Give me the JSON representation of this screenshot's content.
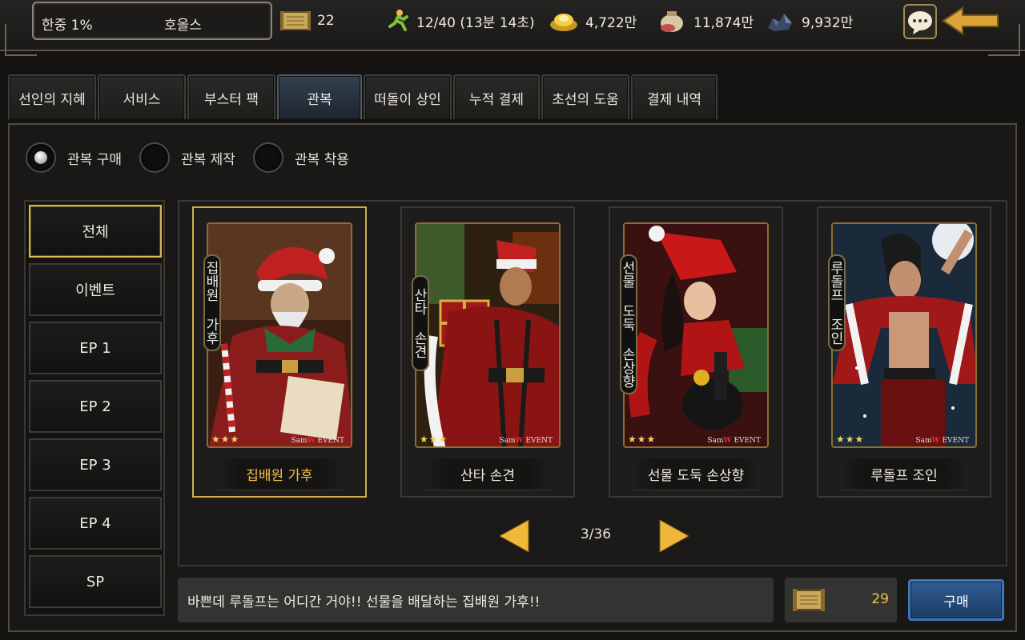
{
  "topbar": {
    "rank": "한중 1%",
    "player_name": "호올스",
    "scroll_count": "22",
    "stamina": "12/40 (13분 14초)",
    "gold": "4,722만",
    "food": "11,874만",
    "ore": "9,932만"
  },
  "tabs": [
    {
      "label": "선인의 지혜"
    },
    {
      "label": "서비스"
    },
    {
      "label": "부스터 팩"
    },
    {
      "label": "관복",
      "active": true
    },
    {
      "label": "떠돌이 상인"
    },
    {
      "label": "누적 결제"
    },
    {
      "label": "초선의 도움"
    },
    {
      "label": "결제 내역"
    }
  ],
  "modes": [
    {
      "label": "관복 구매",
      "selected": true
    },
    {
      "label": "관복 제작",
      "selected": false
    },
    {
      "label": "관복 착용",
      "selected": false
    }
  ],
  "categories": [
    {
      "label": "전체",
      "active": true
    },
    {
      "label": "이벤트"
    },
    {
      "label": "EP 1"
    },
    {
      "label": "EP 2"
    },
    {
      "label": "EP 3"
    },
    {
      "label": "EP 4"
    },
    {
      "label": "SP"
    }
  ],
  "cards": [
    {
      "title": "집배원 가후",
      "vertical_name": "집배원 가후",
      "stars": "★★★",
      "tag_pre": "Sam",
      "tag_mid": "W",
      "tag_post": "EVENT",
      "selected": true
    },
    {
      "title": "산타 손견",
      "vertical_name": "산타 손견",
      "stars": "★★★",
      "tag_pre": "Sam",
      "tag_mid": "W",
      "tag_post": "EVENT"
    },
    {
      "title": "선물 도둑 손상향",
      "vertical_name": "선물 도둑 손상향",
      "stars": "★★★",
      "tag_pre": "Sam",
      "tag_mid": "W",
      "tag_post": "EVENT"
    },
    {
      "title": "루돌프 조인",
      "vertical_name": "루돌프 조인",
      "stars": "★★★",
      "tag_pre": "Sam",
      "tag_mid": "W",
      "tag_post": "EVENT"
    }
  ],
  "pager": {
    "text": "3/36"
  },
  "description": "바쁜데 루돌프는 어디간 거야!! 선물을 배달하는 집배원 가후!!",
  "price": "29",
  "buy_label": "구매",
  "colors": {
    "accent_gold": "#f2c34a",
    "buy_blue": "#2f5c92",
    "selected_border": "#d0ae48"
  }
}
